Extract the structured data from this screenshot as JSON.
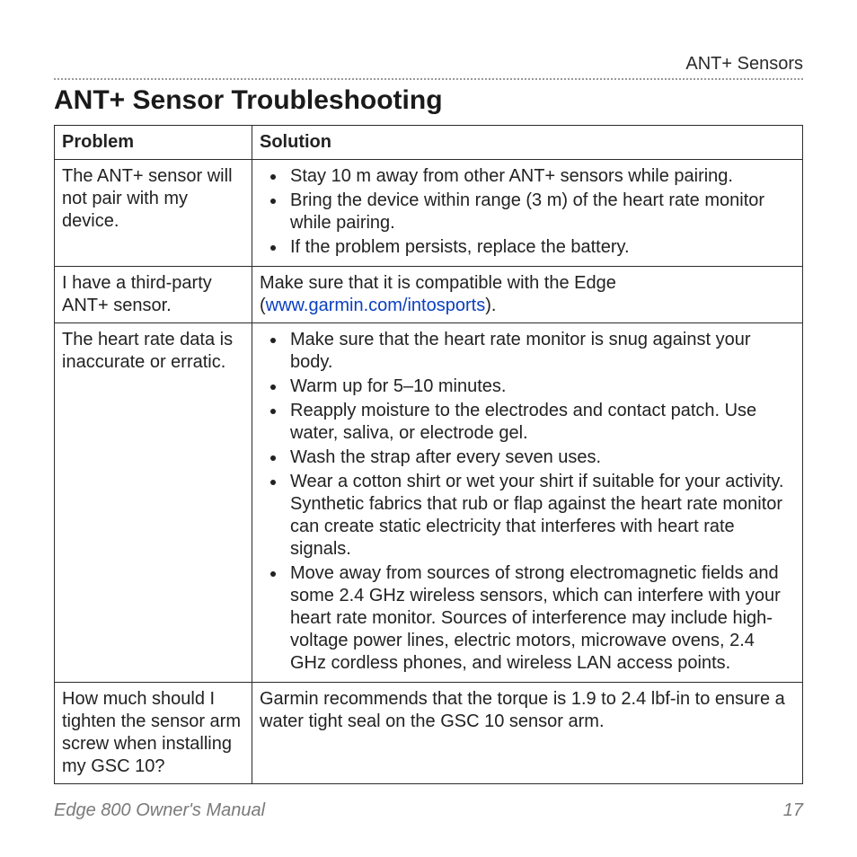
{
  "header": {
    "running_head": "ANT+ Sensors"
  },
  "title": "ANT+ Sensor Troubleshooting",
  "table": {
    "headers": {
      "problem": "Problem",
      "solution": "Solution"
    },
    "rows": [
      {
        "problem": "The ANT+ sensor will not pair with my device.",
        "solution_type": "bullets",
        "bullets": [
          "Stay 10 m away from other ANT+ sensors while pairing.",
          "Bring the device within range (3 m) of the heart rate monitor while pairing.",
          "If the problem persists, replace the battery."
        ]
      },
      {
        "problem": "I have a third-party ANT+ sensor.",
        "solution_type": "text_with_link",
        "text_before": "Make sure that it is compatible with the Edge (",
        "link_text": "www.garmin.com/intosports",
        "text_after": ")."
      },
      {
        "problem": "The heart rate data is inaccurate or erratic.",
        "solution_type": "bullets",
        "bullets": [
          "Make sure that the heart rate monitor is snug against your body.",
          "Warm up for 5–10 minutes.",
          "Reapply moisture to the electrodes and contact patch. Use water, saliva, or electrode gel.",
          "Wash the strap after every seven uses.",
          "Wear a cotton shirt or wet your shirt if suitable for your activity. Synthetic fabrics that rub or flap against the heart rate monitor can create static electricity that interferes with heart rate signals.",
          "Move away from sources of strong electromagnetic fields and some 2.4 GHz wireless sensors, which can interfere with your heart rate monitor. Sources of interference may include high-voltage power lines, electric motors, microwave ovens, 2.4 GHz cordless phones, and wireless LAN access points."
        ]
      },
      {
        "problem": "How much should I tighten the sensor arm screw when installing my GSC 10?",
        "solution_type": "text",
        "text": "Garmin recommends that the torque is 1.9 to 2.4 lbf-in to ensure a water tight seal on the GSC 10 sensor arm."
      }
    ]
  },
  "footer": {
    "manual_title": "Edge 800 Owner's Manual",
    "page_number": "17"
  }
}
